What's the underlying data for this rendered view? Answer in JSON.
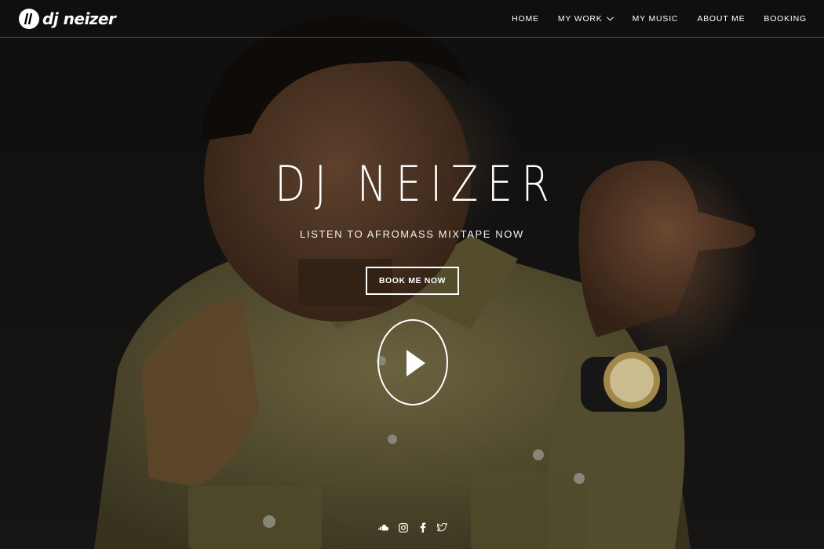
{
  "brand": {
    "name": "dj neizer"
  },
  "nav": {
    "items": [
      {
        "label": "HOME"
      },
      {
        "label": "MY WORK"
      },
      {
        "label": "MY MUSIC"
      },
      {
        "label": "ABOUT ME"
      },
      {
        "label": "BOOKING"
      }
    ]
  },
  "hero": {
    "title": "DJ NEIZER",
    "subtitle": "LISTEN TO AFROMASS MIXTAPE NOW",
    "cta_label": "BOOK ME NOW",
    "play_icon": "play-icon"
  },
  "social": {
    "icons": [
      "soundcloud-icon",
      "instagram-icon",
      "facebook-icon",
      "twitter-icon"
    ]
  },
  "colors": {
    "text": "#ffffff",
    "background": "#0d0d0d",
    "shirt": "#6b6440"
  }
}
